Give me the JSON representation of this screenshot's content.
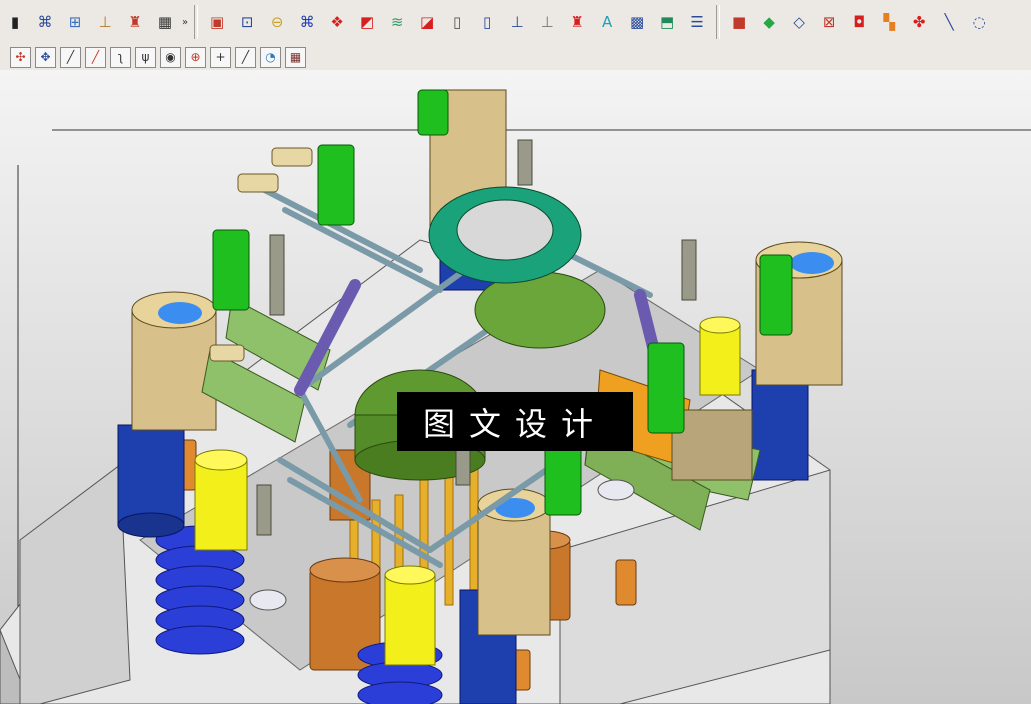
{
  "toolbar_main": {
    "buttons": [
      {
        "icon": "select-icon",
        "glyph": "▮",
        "color": "#222222"
      },
      {
        "icon": "assembly-icon",
        "glyph": "⌘",
        "color": "#2a4b9b"
      },
      {
        "icon": "component-tree-icon",
        "glyph": "⊞",
        "color": "#3a6fbf"
      },
      {
        "icon": "mold-base-icon",
        "glyph": "⊥",
        "color": "#b07a2a"
      },
      {
        "icon": "ejector-icon",
        "glyph": "♜",
        "color": "#c0392b"
      },
      {
        "icon": "table-grid-icon",
        "glyph": "▦",
        "color": "#333333"
      }
    ],
    "overflow_glyph": "»",
    "feature_buttons": [
      {
        "icon": "cavity-layout-icon",
        "glyph": "▣",
        "color": "#c0392b"
      },
      {
        "icon": "insert-pocket-icon",
        "glyph": "⊡",
        "color": "#2a4b9b"
      },
      {
        "icon": "gate-icon",
        "glyph": "⊖",
        "color": "#c9a227"
      },
      {
        "icon": "runner-icon",
        "glyph": "⌘",
        "color": "#1f3fae"
      },
      {
        "icon": "slider-icon",
        "glyph": "❖",
        "color": "#d71f1f"
      },
      {
        "icon": "lifter-icon",
        "glyph": "◩",
        "color": "#d71f1f"
      },
      {
        "icon": "cooling-icon",
        "glyph": "≋",
        "color": "#3a9b6b"
      },
      {
        "icon": "electrode-icon",
        "glyph": "◪",
        "color": "#d71f1f"
      },
      {
        "icon": "standard-part-icon",
        "glyph": "▯",
        "color": "#555555"
      },
      {
        "icon": "pin-icon",
        "glyph": "▯",
        "color": "#2a4b9b"
      },
      {
        "icon": "sprue-icon",
        "glyph": "⊥",
        "color": "#2a4b9b"
      },
      {
        "icon": "bushing-icon",
        "glyph": "⊥",
        "color": "#777777"
      },
      {
        "icon": "ejector-pin-icon",
        "glyph": "♜",
        "color": "#d71f1f"
      },
      {
        "icon": "text-icon",
        "glyph": "A",
        "color": "#1fa0b8"
      },
      {
        "icon": "hatch-icon",
        "glyph": "▩",
        "color": "#2a4b9b"
      },
      {
        "icon": "pocket-icon",
        "glyph": "⬒",
        "color": "#1f8b5a"
      },
      {
        "icon": "bom-icon",
        "glyph": "☰",
        "color": "#2a4b9b"
      }
    ],
    "view_buttons": [
      {
        "icon": "solid-cube-icon",
        "glyph": "■",
        "color": "#c0392b"
      },
      {
        "icon": "green-diamond-icon",
        "glyph": "◆",
        "color": "#27a844"
      },
      {
        "icon": "wireframe-cube-icon",
        "glyph": "◇",
        "color": "#2a4b9b"
      },
      {
        "icon": "section-view-icon",
        "glyph": "⊠",
        "color": "#c0392b"
      },
      {
        "icon": "face-color-icon",
        "glyph": "◘",
        "color": "#d71f1f"
      },
      {
        "icon": "palette-icon",
        "glyph": "▚",
        "color": "#e67e22"
      },
      {
        "icon": "view-section-icon",
        "glyph": "✤",
        "color": "#d71f1f"
      },
      {
        "icon": "line-icon",
        "glyph": "╲",
        "color": "#2a4b9b"
      },
      {
        "icon": "more-icon",
        "glyph": "◌",
        "color": "#2a4b9b"
      }
    ]
  },
  "toolbar_snap": {
    "buttons": [
      {
        "icon": "snap-point-icon",
        "glyph": "✣",
        "color": "#c0392b"
      },
      {
        "icon": "snap-mid-icon",
        "glyph": "✥",
        "color": "#2a4b9b"
      },
      {
        "icon": "snap-endpoint-icon",
        "glyph": "╱",
        "color": "#333333"
      },
      {
        "icon": "snap-midpoint-icon",
        "glyph": "╱",
        "color": "#c0392b"
      },
      {
        "icon": "snap-control-icon",
        "glyph": "ʅ",
        "color": "#333333"
      },
      {
        "icon": "snap-intersection-icon",
        "glyph": "ψ",
        "color": "#333333"
      },
      {
        "icon": "snap-arc-center-icon",
        "glyph": "◉",
        "color": "#333333"
      },
      {
        "icon": "snap-quadrant-icon",
        "glyph": "⊕",
        "color": "#c0392b"
      },
      {
        "icon": "snap-existing-point-icon",
        "glyph": "+",
        "color": "#333333"
      },
      {
        "icon": "snap-on-curve-icon",
        "glyph": "╱",
        "color": "#333333"
      },
      {
        "icon": "snap-on-face-icon",
        "glyph": "◔",
        "color": "#2a7bbf"
      },
      {
        "icon": "snap-grid-icon",
        "glyph": "▦",
        "color": "#7a3030"
      }
    ]
  },
  "colors": {
    "viewport_bg": "#d8d8d8",
    "bushing_tan": "#d8c08a",
    "guide_blue": "#1e3fae",
    "bolt_green": "#1fbf1f",
    "ring_teal": "#1aa37a",
    "plate_green": "#8fc06a",
    "orange_part": "#f0a020"
  },
  "watermark": {
    "text": "图文设计"
  }
}
